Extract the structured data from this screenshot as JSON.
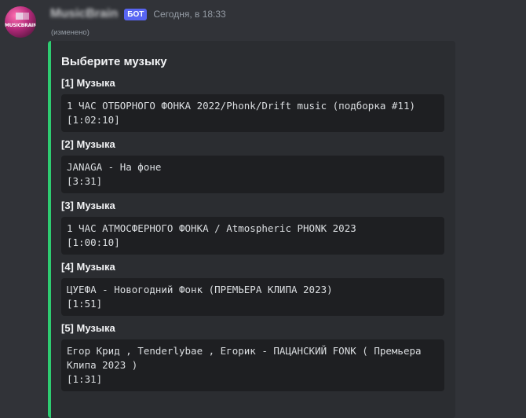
{
  "message": {
    "avatar_text": "MUSICBRAIN",
    "username": "MusicBrain",
    "bot_badge": "БОТ",
    "timestamp": "Сегодня, в 18:33",
    "edited": "(изменено)"
  },
  "embed": {
    "accent_color": "#2ecc71",
    "title": "Выберите музыку",
    "fields": [
      {
        "name": "[1] Музыка",
        "title": "1 ЧАС ОТБОРНОГО ФОНКА 2022/Phonk/Drift music (подборка #11)",
        "duration": "[1:02:10]"
      },
      {
        "name": "[2] Музыка",
        "title": "JANAGA - На фоне",
        "duration": "[3:31]"
      },
      {
        "name": "[3] Музыка",
        "title": "1 ЧАС АТМОСФЕРНОГО ФОНКА / Atmospheric PHONK 2023",
        "duration": "[1:00:10]"
      },
      {
        "name": "[4] Музыка",
        "title": "ЦУЕФА - Новогодний Фонк (ПРЕМЬЕРА КЛИПА 2023)",
        "duration": "[1:51]"
      },
      {
        "name": "[5] Музыка",
        "title": "Егор Крид , Tenderlybae , Егорик - ПАЦАНСКИЙ FONK ( Премьера Клипа 2023 )",
        "duration": "[1:31]"
      }
    ]
  }
}
